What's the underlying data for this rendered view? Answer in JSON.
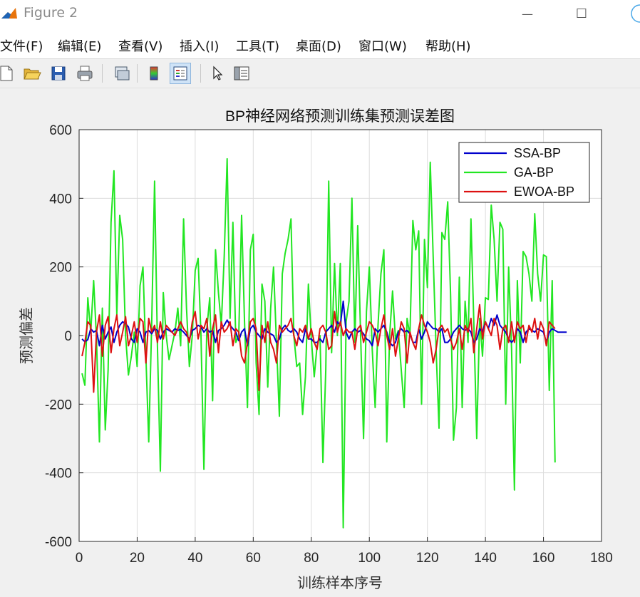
{
  "window": {
    "title": "Figure 2",
    "minimize_glyph": "—",
    "maximize_glyph": "☐"
  },
  "menu": {
    "items": [
      "文件(F)",
      "编辑(E)",
      "查看(V)",
      "插入(I)",
      "工具(T)",
      "桌面(D)",
      "窗口(W)",
      "帮助(H)"
    ]
  },
  "toolbar": {
    "icons": [
      "new-figure-icon",
      "open-folder-icon",
      "save-icon",
      "print-icon",
      "link-figure-icon",
      "colorbar-icon",
      "legend-icon",
      "pointer-icon",
      "property-inspector-icon"
    ]
  },
  "chart_data": {
    "type": "line",
    "title": "BP神经网络预测训练集预测误差图",
    "xlabel": "训练样本序号",
    "ylabel": "预测偏差",
    "xlim": [
      0,
      180
    ],
    "ylim": [
      -600,
      600
    ],
    "xticks": [
      0,
      20,
      40,
      60,
      80,
      100,
      120,
      140,
      160,
      180
    ],
    "yticks": [
      -600,
      -400,
      -200,
      0,
      200,
      400,
      600
    ],
    "grid": true,
    "legend_position": "top-right",
    "x_start": 1,
    "x_step": 1,
    "series": [
      {
        "name": "SSA-BP",
        "color": "#0000cc",
        "values": [
          -10,
          -18,
          -12,
          20,
          10,
          15,
          -30,
          30,
          -10,
          10,
          25,
          -20,
          10,
          30,
          40,
          35,
          25,
          -10,
          -20,
          20,
          10,
          -20,
          10,
          15,
          5,
          20,
          15,
          -10,
          10,
          20,
          15,
          10,
          20,
          15,
          18,
          10,
          0,
          -10,
          15,
          20,
          30,
          25,
          10,
          20,
          10,
          15,
          -20,
          15,
          20,
          30,
          45,
          30,
          20,
          10,
          -15,
          10,
          20,
          -30,
          20,
          30,
          10,
          0,
          -10,
          20,
          10,
          5,
          0,
          -20,
          -10,
          20,
          30,
          15,
          10,
          20,
          10,
          -10,
          -20,
          20,
          -10,
          -10,
          -20,
          -20,
          -10,
          -20,
          10,
          20,
          30,
          10,
          40,
          30,
          100,
          10,
          -10,
          10,
          20,
          10,
          15,
          5,
          -10,
          -15,
          -30,
          20,
          10,
          20,
          30,
          10,
          -20,
          -30,
          -20,
          10,
          20,
          10,
          15,
          5,
          -20,
          -20,
          20,
          -10,
          10,
          40,
          30,
          20,
          20,
          10,
          20,
          -20,
          -20,
          -10,
          10,
          20,
          30,
          20,
          15,
          20,
          10,
          -20,
          -10,
          20,
          10,
          40,
          20,
          50,
          30,
          60,
          30,
          20,
          10,
          -10,
          -20,
          -10,
          20,
          10,
          -20,
          10,
          20,
          15,
          10,
          20,
          15,
          10,
          -20,
          10,
          20,
          15,
          10,
          10,
          10,
          10
        ]
      },
      {
        "name": "GA-BP",
        "color": "#22e622",
        "values": [
          -110,
          -145,
          110,
          10,
          160,
          -10,
          -310,
          80,
          -275,
          -100,
          330,
          480,
          60,
          350,
          280,
          0,
          -115,
          -60,
          10,
          -90,
          145,
          200,
          -60,
          -310,
          30,
          450,
          -30,
          -395,
          125,
          0,
          -70,
          -30,
          10,
          80,
          -30,
          340,
          80,
          -90,
          0,
          190,
          225,
          0,
          -390,
          20,
          110,
          -190,
          250,
          125,
          30,
          230,
          515,
          50,
          330,
          -20,
          0,
          350,
          40,
          -210,
          250,
          295,
          -80,
          -230,
          150,
          100,
          -150,
          80,
          200,
          -20,
          -235,
          180,
          240,
          280,
          340,
          0,
          -90,
          -80,
          -230,
          -120,
          150,
          -10,
          -120,
          -30,
          0,
          -370,
          -100,
          450,
          -50,
          210,
          0,
          210,
          -560,
          40,
          100,
          400,
          -20,
          320,
          0,
          -300,
          70,
          200,
          -40,
          -210,
          30,
          180,
          250,
          -310,
          0,
          130,
          -10,
          15,
          -100,
          -210,
          50,
          0,
          335,
          250,
          305,
          -200,
          280,
          140,
          505,
          230,
          -40,
          -270,
          300,
          280,
          390,
          120,
          -305,
          -210,
          170,
          -210,
          100,
          -20,
          340,
          40,
          -300,
          50,
          -60,
          110,
          105,
          380,
          280,
          100,
          330,
          310,
          -200,
          200,
          -40,
          -450,
          160,
          -80,
          245,
          230,
          180,
          100,
          355,
          180,
          100,
          235,
          230,
          -160,
          160,
          -370
        ]
      },
      {
        "name": "EWOA-BP",
        "color": "#dd1111",
        "values": [
          -60,
          -20,
          40,
          30,
          -165,
          10,
          60,
          -60,
          30,
          55,
          -50,
          20,
          60,
          -30,
          10,
          55,
          -30,
          0,
          40,
          -20,
          50,
          40,
          -80,
          50,
          10,
          30,
          -20,
          40,
          -10,
          30,
          20,
          10,
          0,
          20,
          40,
          20,
          10,
          -20,
          40,
          70,
          -10,
          30,
          20,
          50,
          -60,
          20,
          60,
          -50,
          40,
          10,
          20,
          40,
          -30,
          20,
          10,
          -60,
          -80,
          -20,
          40,
          50,
          20,
          -160,
          30,
          -20,
          40,
          -20,
          -40,
          -80,
          30,
          10,
          20,
          30,
          50,
          0,
          -30,
          20,
          10,
          30,
          -10,
          20,
          -20,
          -40,
          20,
          30,
          10,
          -40,
          -30,
          70,
          10,
          40,
          0,
          20,
          10,
          10,
          -40,
          20,
          30,
          -20,
          10,
          40,
          30,
          10,
          -30,
          20,
          60,
          0,
          -40,
          20,
          -60,
          -10,
          40,
          20,
          -80,
          10,
          -20,
          -40,
          20,
          60,
          30,
          10,
          -20,
          -80,
          -40,
          20,
          30,
          10,
          20,
          -10,
          -40,
          -20,
          20,
          -40,
          30,
          10,
          50,
          -50,
          20,
          90,
          -10,
          40,
          20,
          0,
          50,
          30,
          -40,
          20,
          30,
          -20,
          40,
          -20,
          40,
          20,
          30,
          -20,
          30,
          10,
          50,
          -10,
          40,
          20,
          -30,
          40,
          30,
          20
        ]
      }
    ]
  }
}
